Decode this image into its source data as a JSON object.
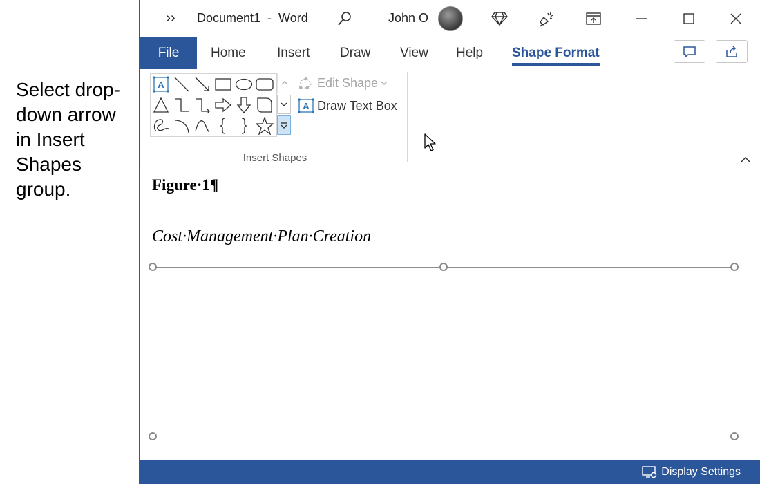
{
  "instruction": "Select drop-down arrow in Insert Shapes group.",
  "titlebar": {
    "more": "››",
    "title": "Document1  -  Word",
    "user": "John O"
  },
  "tabs": [
    "File",
    "Home",
    "Insert",
    "Draw",
    "View",
    "Help",
    "Shape Format"
  ],
  "ribbon": {
    "edit_shape": "Edit Shape",
    "draw_text_box": "Draw Text Box",
    "group_label": "Insert Shapes",
    "shapes_row1": [
      "text-box-icon",
      "line-icon",
      "arrow-line-icon",
      "rectangle-icon",
      "oval-icon",
      "rounded-rectangle-icon"
    ],
    "shapes_row2": [
      "triangle-icon",
      "elbow-connector-icon",
      "elbow-arrow-connector-icon",
      "right-arrow-icon",
      "down-arrow-icon",
      "snip-corner-icon"
    ],
    "shapes_row3": [
      "freeform-scribble-icon",
      "arc-icon",
      "curve-icon",
      "left-brace-icon",
      "right-brace-icon",
      "star-icon"
    ]
  },
  "document": {
    "figure_title": "Figure·1¶",
    "figure_subtitle": "Cost·Management·Plan·Creation"
  },
  "statusbar": {
    "display_settings": "Display Settings"
  },
  "colors": {
    "accent": "#2b579a",
    "selection": "#cde4f7"
  }
}
